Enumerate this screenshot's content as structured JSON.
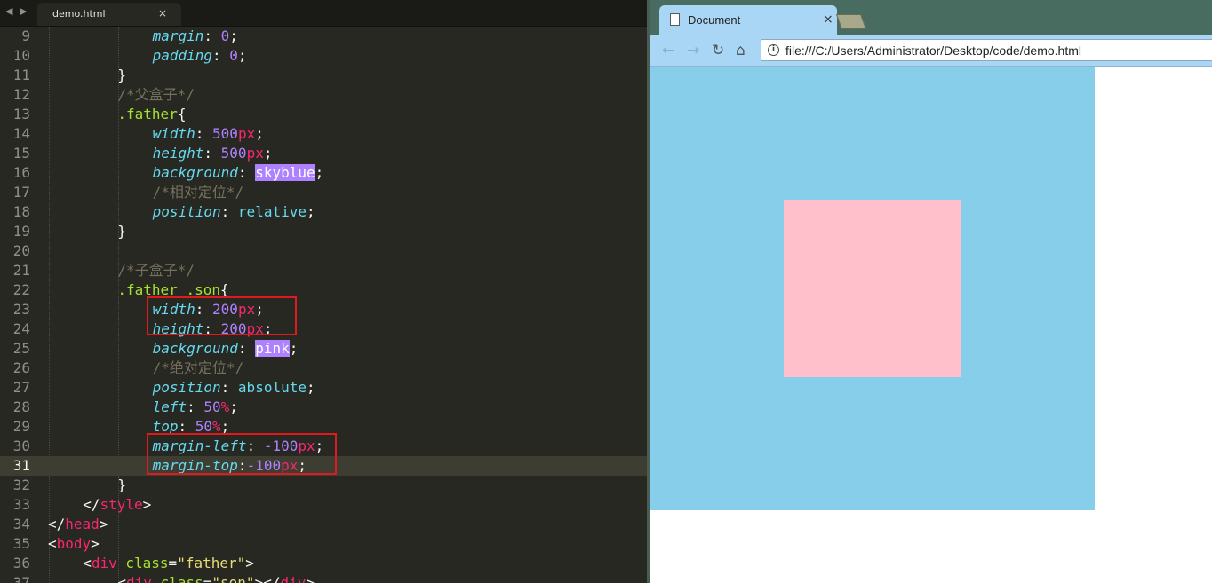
{
  "editor": {
    "nav_back": "◀",
    "nav_forward": "▶",
    "tab": {
      "label": "demo.html",
      "close": "×"
    },
    "lines": [
      {
        "n": "9",
        "indent": 3,
        "tokens": [
          [
            "prop",
            "margin"
          ],
          [
            "p",
            ": "
          ],
          [
            "num",
            "0"
          ],
          [
            "p",
            ";"
          ]
        ]
      },
      {
        "n": "10",
        "indent": 3,
        "tokens": [
          [
            "prop",
            "padding"
          ],
          [
            "p",
            ": "
          ],
          [
            "num",
            "0"
          ],
          [
            "p",
            ";"
          ]
        ]
      },
      {
        "n": "11",
        "indent": 2,
        "tokens": [
          [
            "p",
            "}"
          ]
        ]
      },
      {
        "n": "12",
        "indent": 2,
        "tokens": [
          [
            "cmt",
            "/*父盒子*/"
          ]
        ]
      },
      {
        "n": "13",
        "indent": 2,
        "tokens": [
          [
            "sel",
            ".father"
          ],
          [
            "p",
            "{"
          ]
        ]
      },
      {
        "n": "14",
        "indent": 3,
        "tokens": [
          [
            "prop",
            "width"
          ],
          [
            "p",
            ": "
          ],
          [
            "num",
            "500"
          ],
          [
            "unit",
            "px"
          ],
          [
            "p",
            ";"
          ]
        ]
      },
      {
        "n": "15",
        "indent": 3,
        "tokens": [
          [
            "prop",
            "height"
          ],
          [
            "p",
            ": "
          ],
          [
            "num",
            "500"
          ],
          [
            "unit",
            "px"
          ],
          [
            "p",
            ";"
          ]
        ]
      },
      {
        "n": "16",
        "indent": 3,
        "tokens": [
          [
            "prop",
            "background"
          ],
          [
            "p",
            ": "
          ],
          [
            "hl",
            "skyblue"
          ],
          [
            "p",
            ";"
          ]
        ]
      },
      {
        "n": "17",
        "indent": 3,
        "tokens": [
          [
            "cmt",
            "/*相对定位*/"
          ]
        ]
      },
      {
        "n": "18",
        "indent": 3,
        "tokens": [
          [
            "prop",
            "position"
          ],
          [
            "p",
            ": "
          ],
          [
            "val",
            "relative"
          ],
          [
            "p",
            ";"
          ]
        ]
      },
      {
        "n": "19",
        "indent": 2,
        "tokens": [
          [
            "p",
            "}"
          ]
        ]
      },
      {
        "n": "20",
        "indent": 0,
        "tokens": []
      },
      {
        "n": "21",
        "indent": 2,
        "tokens": [
          [
            "cmt",
            "/*子盒子*/"
          ]
        ]
      },
      {
        "n": "22",
        "indent": 2,
        "tokens": [
          [
            "sel",
            ".father .son"
          ],
          [
            "p",
            "{"
          ]
        ]
      },
      {
        "n": "23",
        "indent": 3,
        "tokens": [
          [
            "prop",
            "width"
          ],
          [
            "p",
            ": "
          ],
          [
            "num",
            "200"
          ],
          [
            "unit",
            "px"
          ],
          [
            "p",
            ";"
          ]
        ]
      },
      {
        "n": "24",
        "indent": 3,
        "tokens": [
          [
            "prop",
            "height"
          ],
          [
            "p",
            ": "
          ],
          [
            "num",
            "200"
          ],
          [
            "unit",
            "px"
          ],
          [
            "p",
            ";"
          ]
        ]
      },
      {
        "n": "25",
        "indent": 3,
        "tokens": [
          [
            "prop",
            "background"
          ],
          [
            "p",
            ": "
          ],
          [
            "hl",
            "pink"
          ],
          [
            "p",
            ";"
          ]
        ]
      },
      {
        "n": "26",
        "indent": 3,
        "tokens": [
          [
            "cmt",
            "/*绝对定位*/"
          ]
        ]
      },
      {
        "n": "27",
        "indent": 3,
        "tokens": [
          [
            "prop",
            "position"
          ],
          [
            "p",
            ": "
          ],
          [
            "val",
            "absolute"
          ],
          [
            "p",
            ";"
          ]
        ]
      },
      {
        "n": "28",
        "indent": 3,
        "tokens": [
          [
            "prop",
            "left"
          ],
          [
            "p",
            ": "
          ],
          [
            "num",
            "50"
          ],
          [
            "unit",
            "%"
          ],
          [
            "p",
            ";"
          ]
        ]
      },
      {
        "n": "29",
        "indent": 3,
        "tokens": [
          [
            "prop",
            "top"
          ],
          [
            "p",
            ": "
          ],
          [
            "num",
            "50"
          ],
          [
            "unit",
            "%"
          ],
          [
            "p",
            ";"
          ]
        ]
      },
      {
        "n": "30",
        "indent": 3,
        "tokens": [
          [
            "prop",
            "margin-left"
          ],
          [
            "p",
            ": "
          ],
          [
            "num",
            "-100"
          ],
          [
            "unit",
            "px"
          ],
          [
            "p",
            ";"
          ]
        ]
      },
      {
        "n": "31",
        "indent": 3,
        "tokens": [
          [
            "prop",
            "margin-top"
          ],
          [
            "p",
            ":"
          ],
          [
            "num",
            "-100"
          ],
          [
            "unit",
            "px"
          ],
          [
            "p",
            ";"
          ]
        ]
      },
      {
        "n": "32",
        "indent": 2,
        "tokens": [
          [
            "p",
            "}"
          ]
        ]
      },
      {
        "n": "33",
        "indent": 1,
        "tokens": [
          [
            "p",
            "</"
          ],
          [
            "tag",
            "style"
          ],
          [
            "p",
            ">"
          ]
        ]
      },
      {
        "n": "34",
        "indent": 0,
        "tokens": [
          [
            "p",
            "</"
          ],
          [
            "tag",
            "head"
          ],
          [
            "p",
            ">"
          ]
        ]
      },
      {
        "n": "35",
        "indent": 0,
        "tokens": [
          [
            "p",
            "<"
          ],
          [
            "tag",
            "body"
          ],
          [
            "p",
            ">"
          ]
        ]
      },
      {
        "n": "36",
        "indent": 1,
        "tokens": [
          [
            "p",
            "<"
          ],
          [
            "tag",
            "div"
          ],
          [
            "p",
            " "
          ],
          [
            "attr",
            "class"
          ],
          [
            "p",
            "="
          ],
          [
            "str",
            "\"father\""
          ],
          [
            "p",
            ">"
          ]
        ]
      },
      {
        "n": "37",
        "indent": 2,
        "tokens": [
          [
            "p",
            "<"
          ],
          [
            "tag",
            "div"
          ],
          [
            "p",
            " "
          ],
          [
            "attr",
            "class"
          ],
          [
            "p",
            "="
          ],
          [
            "str",
            "\"son\""
          ],
          [
            "p",
            "></"
          ],
          [
            "tag",
            "div"
          ],
          [
            "p",
            ">"
          ]
        ]
      }
    ],
    "active_line": "31"
  },
  "browser": {
    "tab": {
      "title": "Document",
      "close": "×"
    },
    "back": "←",
    "forward": "→",
    "reload": "↻",
    "home": "⌂",
    "info": "i",
    "url": "file:///C:/Users/Administrator/Desktop/code/demo.html"
  },
  "colors": {
    "father_background": "#87ceeb",
    "son_background": "#ffc0cb",
    "highlight_box": "#e0191f"
  }
}
